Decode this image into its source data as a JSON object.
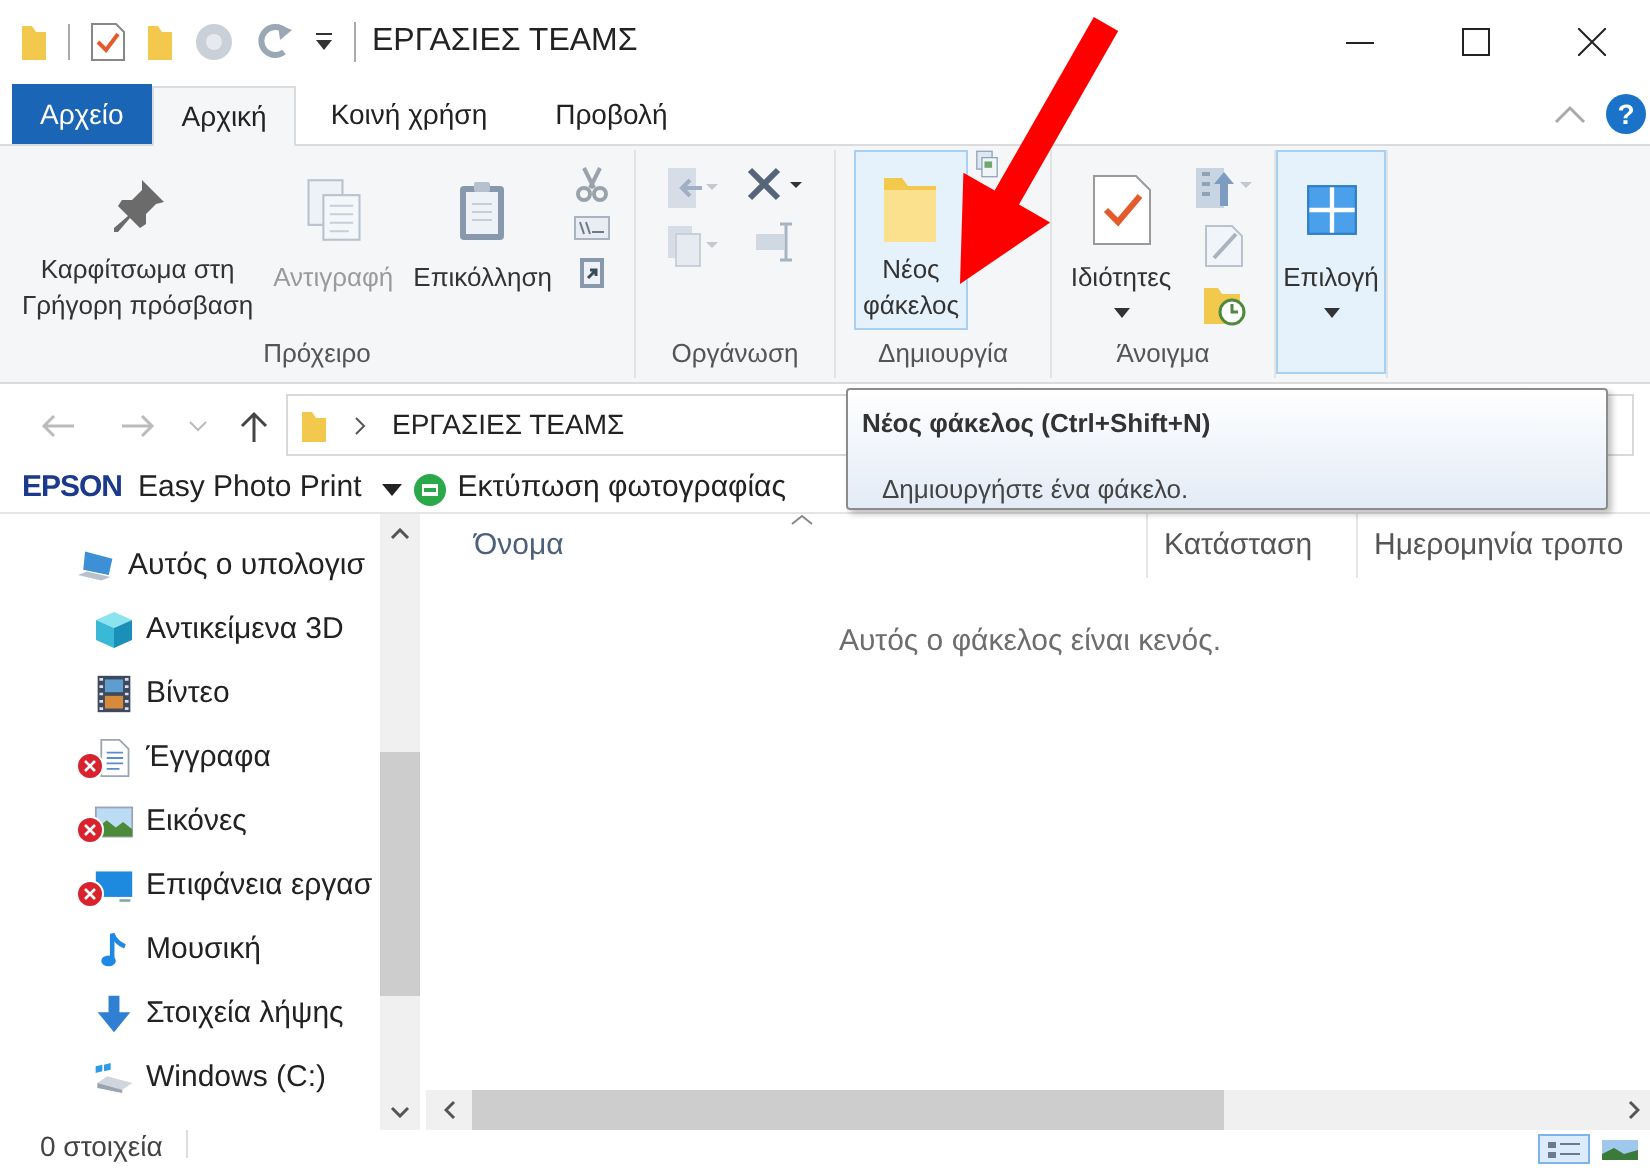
{
  "title_bar": {
    "title": "ΕΡΓΑΣΙΕΣ ΤΕΑΜΣ"
  },
  "ribbon_tabs": [
    {
      "label": "Αρχείο",
      "kind": "file",
      "selected": false
    },
    {
      "label": "Αρχική",
      "kind": "tab",
      "selected": true
    },
    {
      "label": "Κοινή χρήση",
      "kind": "tab",
      "selected": false
    },
    {
      "label": "Προβολή",
      "kind": "tab",
      "selected": false
    }
  ],
  "help_button": "?",
  "ribbon_groups": [
    {
      "label": "Πρόχειρο",
      "items": [
        {
          "kind": "large",
          "label": "Καρφίτσωμα στη\nΓρήγορη πρόσβαση",
          "disabled": false,
          "hovered": false
        },
        {
          "kind": "large",
          "label": "Αντιγραφή",
          "disabled": true,
          "hovered": false
        },
        {
          "kind": "large",
          "label": "Επικόλληση",
          "disabled": false,
          "hovered": false
        },
        {
          "kind": "small"
        }
      ]
    },
    {
      "label": "Οργάνωση",
      "items": [
        {
          "kind": "small"
        },
        {
          "kind": "small"
        }
      ]
    },
    {
      "label": "Δημιουργία",
      "items": [
        {
          "kind": "large",
          "label": "Νέος\nφάκελος",
          "disabled": false,
          "hovered": true
        },
        {
          "kind": "small"
        }
      ]
    },
    {
      "label": "Άνοιγμα",
      "items": [
        {
          "kind": "large",
          "label": "Ιδιότητες",
          "disabled": false,
          "hovered": false,
          "dropdown": true
        },
        {
          "kind": "small"
        }
      ]
    },
    {
      "items": [
        {
          "kind": "large",
          "label": "Επιλογή",
          "disabled": false,
          "hovered": true,
          "dropdown": true
        }
      ]
    }
  ],
  "address_bar": {
    "path": "ΕΡΓΑΣΙΕΣ ΤΕΑΜΣ"
  },
  "epson_toolbar": {
    "brand": "EPSON",
    "app": "Easy Photo Print",
    "action": "Εκτύπωση φωτογραφίας"
  },
  "navigation_pane": [
    {
      "label": "Αυτός ο υπολογισ",
      "error": false,
      "children": [
        {
          "label": "Αντικείμενα 3D",
          "error": false
        },
        {
          "label": "Βίντεο",
          "error": false
        },
        {
          "label": "Έγγραφα",
          "error": true
        },
        {
          "label": "Εικόνες",
          "error": true
        },
        {
          "label": "Επιφάνεια εργασ",
          "error": true
        },
        {
          "label": "Μουσική",
          "error": false
        },
        {
          "label": "Στοιχεία λήψης",
          "error": false
        },
        {
          "label": "Windows (C:)",
          "error": false
        }
      ]
    }
  ],
  "columns": [
    "Όνομα",
    "Κατάσταση",
    "Ημερομηνία τροπο"
  ],
  "empty_message": "Αυτός ο φάκελος είναι κενός.",
  "status_bar": {
    "count": "0 στοιχεία",
    "views": [
      {
        "kind": "details",
        "selected": true
      },
      {
        "kind": "thumbnails",
        "selected": false
      }
    ]
  },
  "tooltip": {
    "title": "Νέος φάκελος (Ctrl+Shift+N)",
    "text": "Δημιουργήστε ένα φάκελο."
  }
}
